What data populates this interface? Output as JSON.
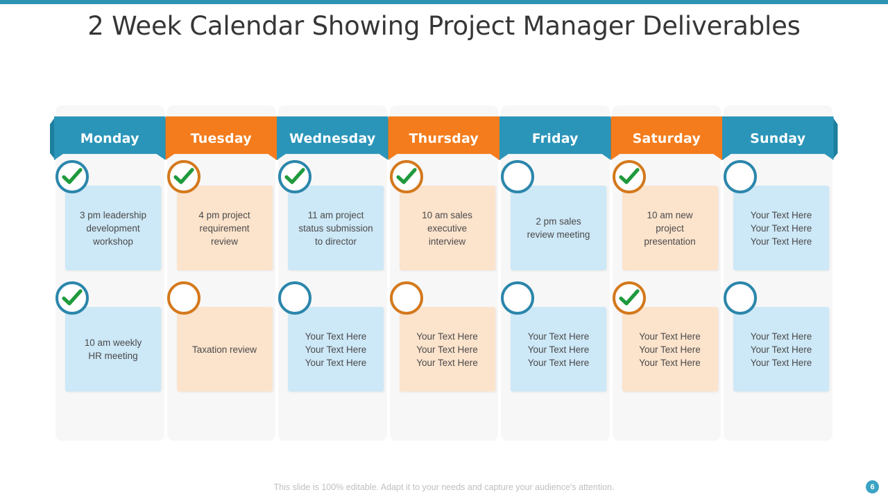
{
  "slide": {
    "title": "2 Week Calendar Showing Project Manager Deliverables",
    "accent_blue": "#2b95b9",
    "accent_orange": "#f47c1c",
    "page_number": "6",
    "footer_note": "This slide is 100% editable. Adapt it to your needs and capture your audience's attention."
  },
  "calendar": {
    "columns": [
      {
        "day": "Monday",
        "theme": "blue",
        "cells": [
          {
            "checked": true,
            "ring": "blue",
            "box": "blue",
            "lines": [
              "3 pm leadership",
              "development",
              "workshop"
            ]
          },
          {
            "checked": true,
            "ring": "blue",
            "box": "blue",
            "lines": [
              "10 am weekly",
              "HR meeting"
            ]
          }
        ]
      },
      {
        "day": "Tuesday",
        "theme": "orange",
        "cells": [
          {
            "checked": true,
            "ring": "orange",
            "box": "orange",
            "lines": [
              "4 pm project",
              "requirement",
              "review"
            ]
          },
          {
            "checked": false,
            "ring": "orange",
            "box": "orange",
            "lines": [
              "Taxation review"
            ]
          }
        ]
      },
      {
        "day": "Wednesday",
        "theme": "blue",
        "cells": [
          {
            "checked": true,
            "ring": "blue",
            "box": "blue",
            "lines": [
              "11 am project",
              "status submission",
              "to director"
            ]
          },
          {
            "checked": false,
            "ring": "blue",
            "box": "blue",
            "lines": [
              "Your Text Here",
              "Your Text Here",
              "Your Text Here"
            ]
          }
        ]
      },
      {
        "day": "Thursday",
        "theme": "orange",
        "cells": [
          {
            "checked": true,
            "ring": "orange",
            "box": "orange",
            "lines": [
              "10 am sales",
              "executive",
              "interview"
            ]
          },
          {
            "checked": false,
            "ring": "orange",
            "box": "orange",
            "lines": [
              "Your Text Here",
              "Your Text Here",
              "Your Text Here"
            ]
          }
        ]
      },
      {
        "day": "Friday",
        "theme": "blue",
        "cells": [
          {
            "checked": false,
            "ring": "blue",
            "box": "blue",
            "lines": [
              "2 pm sales",
              "review meeting"
            ]
          },
          {
            "checked": false,
            "ring": "blue",
            "box": "blue",
            "lines": [
              "Your Text Here",
              "Your Text Here",
              "Your Text Here"
            ]
          }
        ]
      },
      {
        "day": "Saturday",
        "theme": "orange",
        "cells": [
          {
            "checked": true,
            "ring": "orange",
            "box": "orange",
            "lines": [
              "10 am new",
              "project",
              "presentation"
            ]
          },
          {
            "checked": true,
            "ring": "orange",
            "box": "orange",
            "lines": [
              "Your Text Here",
              "Your Text Here",
              "Your Text Here"
            ]
          }
        ]
      },
      {
        "day": "Sunday",
        "theme": "blue",
        "cells": [
          {
            "checked": false,
            "ring": "blue",
            "box": "blue",
            "lines": [
              "Your Text Here",
              "Your Text Here",
              "Your Text Here"
            ]
          },
          {
            "checked": false,
            "ring": "blue",
            "box": "blue",
            "lines": [
              "Your Text Here",
              "Your Text Here",
              "Your Text Here"
            ]
          }
        ]
      }
    ]
  }
}
